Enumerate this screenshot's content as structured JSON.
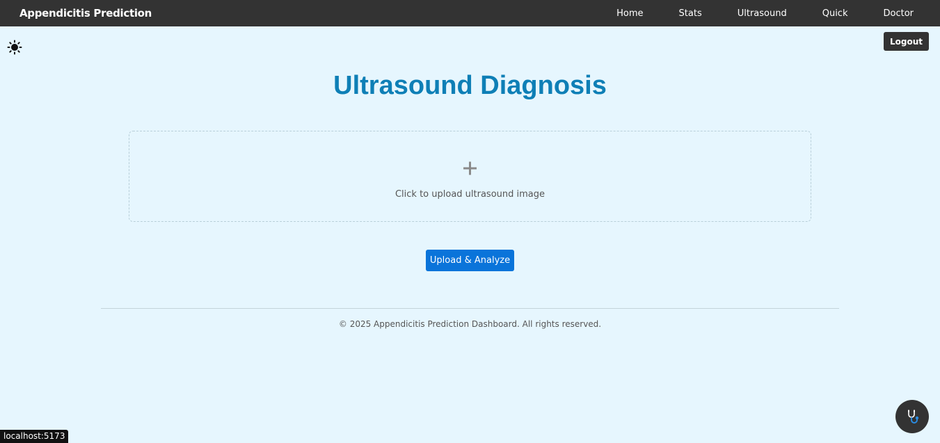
{
  "navbar": {
    "brand": "Appendicitis Prediction",
    "links": [
      "Home",
      "Stats",
      "Ultrasound",
      "Quick",
      "Doctor"
    ]
  },
  "theme_toggle": {
    "icon": "sun-icon"
  },
  "logout_label": "Logout",
  "page_title": "Ultrasound Diagnosis",
  "upload": {
    "icon": "plus-icon",
    "prompt": "Click to upload ultrasound image"
  },
  "analyze_label": "Upload & Analyze",
  "footer": "© 2025 Appendicitis Prediction Dashboard. All rights reserved.",
  "chat_fab": {
    "icon": "stethoscope-icon"
  },
  "status_url": "localhost:5173",
  "colors": {
    "navbar_bg": "#333333",
    "page_bg": "#e6f6fe",
    "title": "#0e7fb6",
    "primary_button": "#0a74da"
  }
}
